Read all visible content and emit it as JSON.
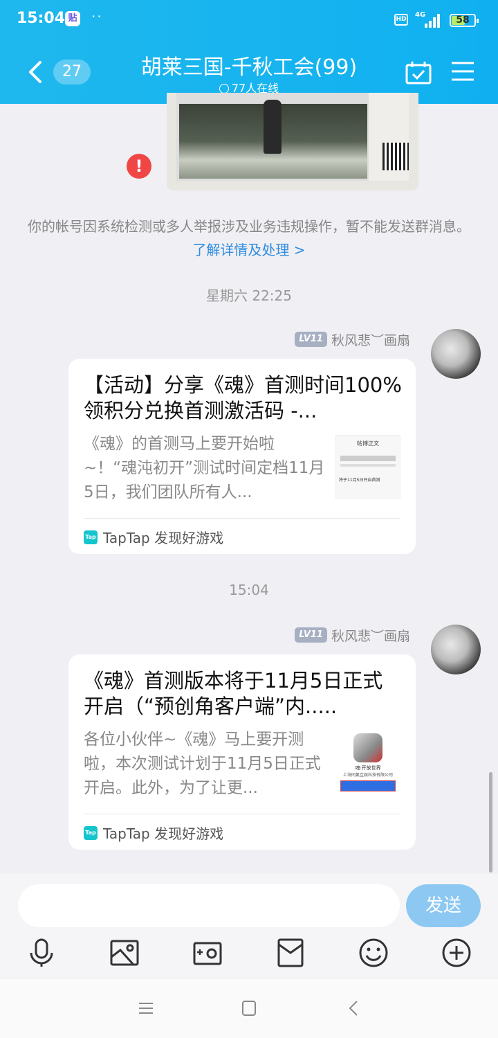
{
  "status_bar": {
    "time": "15:04",
    "app_badge": "贴",
    "dots": "··",
    "hd": "HD",
    "network": "4G",
    "battery": "58",
    "battery_level": 0.58
  },
  "header": {
    "badge_count": "27",
    "title": "胡莱三国-千秋工会(99)",
    "online": "77人在线"
  },
  "notice": {
    "text": "你的帐号因系统检测或多人举报涉及业务违规操作，暂不能发送群消息。",
    "link": "了解详情及处理 >"
  },
  "messages": [
    {
      "time": "星期六 22:25",
      "level": "LV11",
      "sender": "秋风悲︶画扇",
      "title": "【活动】分享《魂》首测时间100%领积分兑换首测激活码 -...",
      "desc": "《魂》的首测马上要开始啦~！“魂沌初开”测试时间定档11月5日，我们团队所有人...",
      "thumb_title": "帖博正文",
      "thumb_text": "将于11月5日开启首测",
      "source": "TapTap 发现好游戏"
    },
    {
      "time": "15:04",
      "level": "LV11",
      "sender": "秋风悲︶画扇",
      "title": "《魂》首测版本将于11月5日正式开启（“预创角客户端”内.....",
      "desc": "各位小伙伴~《魂》马上要开测啦，本次测试计划于11月5日正式开启。此外，为了让更...",
      "thumb_title": "魂:开放世界",
      "thumb_text": "上海同氪互娱科技有限公司",
      "source": "TapTap 发现好游戏"
    }
  ],
  "input": {
    "send": "发送"
  },
  "icons": [
    "microphone-icon",
    "image-icon",
    "camera-icon",
    "red-packet-icon",
    "emoji-icon",
    "plus-icon"
  ],
  "colors": {
    "header": "#1fb8ee",
    "link": "#2e8ce0",
    "error": "#f04646",
    "send": "#8dc8f3"
  }
}
